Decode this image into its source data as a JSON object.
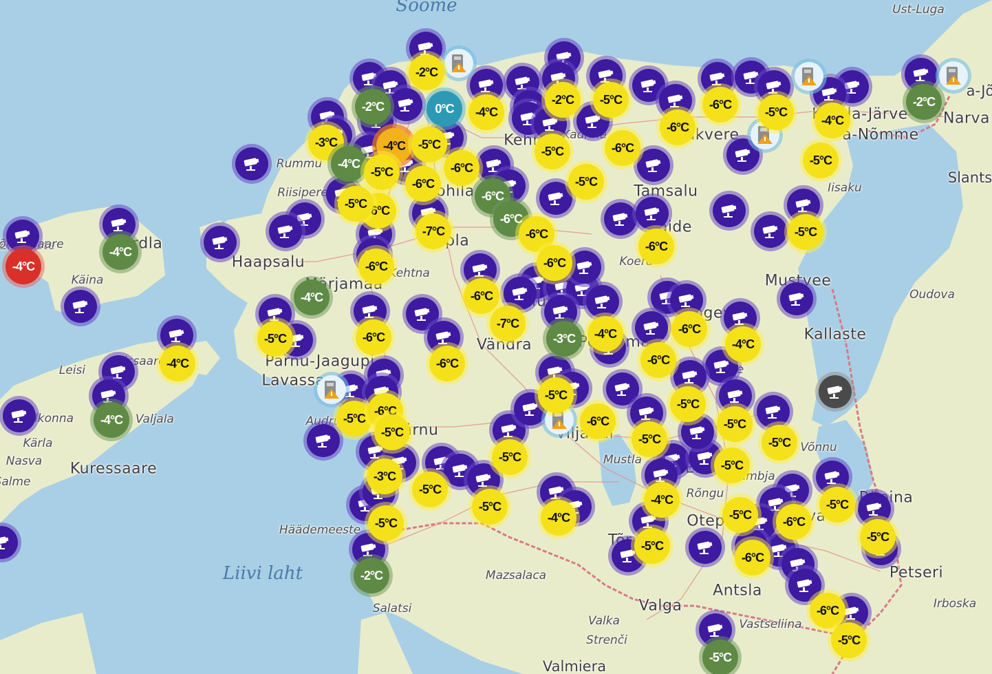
{
  "map": {
    "colors": {
      "sea": "#a9cfe6",
      "land": "#e9eccb",
      "border": "#d57a87",
      "camera": "#3d1aa0",
      "yellow": "#f5e11a",
      "green": "#5e8a45",
      "red": "#d9302a",
      "teal": "#2d9ab5"
    },
    "places": [
      {
        "text": "Soome",
        "size": "sea"
      },
      {
        "text": "Ust-Luga",
        "size": "sm"
      },
      {
        "text": "a-Jõ",
        "size": "md"
      },
      {
        "text": "Narva",
        "size": "lg"
      },
      {
        "text": "Slants",
        "size": "md"
      },
      {
        "text": "Kohtla-Järve",
        "size": "lg"
      },
      {
        "text": "a-Nõmme",
        "size": "lg"
      },
      {
        "text": "Iisaku",
        "size": "sm"
      },
      {
        "text": "Rakvere",
        "size": "lg"
      },
      {
        "text": "Kadrina",
        "size": "sm"
      },
      {
        "text": "Kehra",
        "size": "lg"
      },
      {
        "text": "Tamsalu",
        "size": "lg"
      },
      {
        "text": "Paide",
        "size": "lg"
      },
      {
        "text": "Koeru",
        "size": "sm"
      },
      {
        "text": "Mustvee",
        "size": "lg"
      },
      {
        "text": "Oudova",
        "size": "sm"
      },
      {
        "text": "Kallaste",
        "size": "lg"
      },
      {
        "text": "Jõgeva",
        "size": "lg"
      },
      {
        "text": "Põltsamaa",
        "size": "lg"
      },
      {
        "text": "Palamuse",
        "size": "sm"
      },
      {
        "text": "Rummu",
        "size": "sm"
      },
      {
        "text": "Riisipere",
        "size": "sm"
      },
      {
        "text": "Rapla",
        "size": "lg"
      },
      {
        "text": "Kohila",
        "size": "lg"
      },
      {
        "text": "Kehtna",
        "size": "sm"
      },
      {
        "text": "Haapsalu",
        "size": "lg"
      },
      {
        "text": "Märjamaa",
        "size": "lg"
      },
      {
        "text": "Türi",
        "size": "lg"
      },
      {
        "text": "Vändra",
        "size": "lg"
      },
      {
        "text": "Pärnu-Jaagupi",
        "size": "lg"
      },
      {
        "text": "Lavassaare",
        "size": "lg"
      },
      {
        "text": "Audru",
        "size": "sm"
      },
      {
        "text": "Pärnu",
        "size": "lg"
      },
      {
        "text": "Viljandi",
        "size": "lg"
      },
      {
        "text": "Mustla",
        "size": "sm"
      },
      {
        "text": "Tõrva",
        "size": "lg"
      },
      {
        "text": "Elva",
        "size": "lg"
      },
      {
        "text": "Rõngu",
        "size": "sm"
      },
      {
        "text": "Otepää",
        "size": "lg"
      },
      {
        "text": "Kambja",
        "size": "sm"
      },
      {
        "text": "Võnnu",
        "size": "sm"
      },
      {
        "text": "Räpina",
        "size": "lg"
      },
      {
        "text": "Põlva",
        "size": "lg"
      },
      {
        "text": "Petseri",
        "size": "lg"
      },
      {
        "text": "Irboska",
        "size": "sm"
      },
      {
        "text": "Antsla",
        "size": "lg"
      },
      {
        "text": "Valga",
        "size": "lg"
      },
      {
        "text": "Vastseliina",
        "size": "sm"
      },
      {
        "text": "Valka",
        "size": "sm"
      },
      {
        "text": "Strenči",
        "size": "sm"
      },
      {
        "text": "Valmiera",
        "size": "md"
      },
      {
        "text": "Mazsalaca",
        "size": "sm"
      },
      {
        "text": "Salatsi",
        "size": "sm"
      },
      {
        "text": "Häädemeeste",
        "size": "sm"
      },
      {
        "text": "Liivi laht",
        "size": "sea"
      },
      {
        "text": "Kärdla",
        "size": "lg"
      },
      {
        "text": "Käina",
        "size": "sm"
      },
      {
        "text": "Emmaste",
        "size": "sm"
      },
      {
        "text": "Kõrgessaare",
        "size": "sm"
      },
      {
        "text": "Leisi",
        "size": "sm"
      },
      {
        "text": "Orissaare",
        "size": "sm"
      },
      {
        "text": "Valjala",
        "size": "sm"
      },
      {
        "text": "Kihelkonna",
        "size": "sm"
      },
      {
        "text": "Kärla",
        "size": "sm"
      },
      {
        "text": "Kuressaare",
        "size": "lg"
      },
      {
        "text": "Nasva",
        "size": "sm"
      },
      {
        "text": "Salme",
        "size": "sm"
      }
    ],
    "temperatures": [
      {
        "value": "-2°C",
        "color": "yellow"
      },
      {
        "value": "-2°C",
        "color": "green"
      },
      {
        "value": "0°C",
        "color": "teal"
      },
      {
        "value": "-4°C",
        "color": "yellow"
      },
      {
        "value": "-2°C",
        "color": "yellow"
      },
      {
        "value": "-5°C",
        "color": "yellow"
      },
      {
        "value": "-6°C",
        "color": "yellow"
      },
      {
        "value": "-5°C",
        "color": "yellow"
      },
      {
        "value": "-4°C",
        "color": "yellow"
      },
      {
        "value": "-2°C",
        "color": "green"
      },
      {
        "value": "-3°C",
        "color": "yellow"
      },
      {
        "value": "-4°C",
        "color": "green"
      },
      {
        "value": "-4°C",
        "color": "orange"
      },
      {
        "value": "-5°C",
        "color": "yellow"
      },
      {
        "value": "-5°C",
        "color": "yellow"
      },
      {
        "value": "-6°C",
        "color": "yellow"
      },
      {
        "value": "-6°C",
        "color": "yellow"
      },
      {
        "value": "-5°C",
        "color": "yellow"
      },
      {
        "value": "-6°C",
        "color": "yellow"
      },
      {
        "value": "-6°C",
        "color": "yellow"
      },
      {
        "value": "-5°C",
        "color": "yellow"
      },
      {
        "value": "-6°C",
        "color": "green"
      },
      {
        "value": "-6°C",
        "color": "green"
      },
      {
        "value": "-5°C",
        "color": "yellow"
      },
      {
        "value": "-6°C",
        "color": "yellow"
      },
      {
        "value": "-7°C",
        "color": "yellow"
      },
      {
        "value": "-5°C",
        "color": "yellow"
      },
      {
        "value": "-6°C",
        "color": "yellow"
      },
      {
        "value": "-6°C",
        "color": "yellow"
      },
      {
        "value": "-5°C",
        "color": "yellow"
      },
      {
        "value": "-6°C",
        "color": "yellow"
      },
      {
        "value": "-6°C",
        "color": "yellow"
      },
      {
        "value": "-4°C",
        "color": "green"
      },
      {
        "value": "-6°C",
        "color": "yellow"
      },
      {
        "value": "-7°C",
        "color": "yellow"
      },
      {
        "value": "-3°C",
        "color": "green"
      },
      {
        "value": "-4°C",
        "color": "yellow"
      },
      {
        "value": "-6°C",
        "color": "yellow"
      },
      {
        "value": "-6°C",
        "color": "yellow"
      },
      {
        "value": "-4°C",
        "color": "yellow"
      },
      {
        "value": "-5°C",
        "color": "yellow"
      },
      {
        "value": "-6°C",
        "color": "yellow"
      },
      {
        "value": "-6°C",
        "color": "yellow"
      },
      {
        "value": "-4°C",
        "color": "yellow"
      },
      {
        "value": "-4°C",
        "color": "green"
      },
      {
        "value": "-4°C",
        "color": "red"
      },
      {
        "value": "-4°C",
        "color": "green"
      },
      {
        "value": "-5°C",
        "color": "yellow"
      },
      {
        "value": "-6°C",
        "color": "yellow"
      },
      {
        "value": "-5°C",
        "color": "yellow"
      },
      {
        "value": "-5°C",
        "color": "yellow"
      },
      {
        "value": "-6°C",
        "color": "yellow"
      },
      {
        "value": "-5°C",
        "color": "yellow"
      },
      {
        "value": "-5°C",
        "color": "yellow"
      },
      {
        "value": "-5°C",
        "color": "yellow"
      },
      {
        "value": "-3°C",
        "color": "yellow"
      },
      {
        "value": "-5°C",
        "color": "yellow"
      },
      {
        "value": "-5°C",
        "color": "yellow"
      },
      {
        "value": "-5°C",
        "color": "yellow"
      },
      {
        "value": "-5°C",
        "color": "yellow"
      },
      {
        "value": "-5°C",
        "color": "yellow"
      },
      {
        "value": "-5°C",
        "color": "yellow"
      },
      {
        "value": "-4°C",
        "color": "yellow"
      },
      {
        "value": "-4°C",
        "color": "yellow"
      },
      {
        "value": "-5°C",
        "color": "yellow"
      },
      {
        "value": "-5°C",
        "color": "yellow"
      },
      {
        "value": "-6°C",
        "color": "yellow"
      },
      {
        "value": "-5°C",
        "color": "yellow"
      },
      {
        "value": "-5°C",
        "color": "yellow"
      },
      {
        "value": "-6°C",
        "color": "yellow"
      },
      {
        "value": "-2°C",
        "color": "green"
      },
      {
        "value": "-6°C",
        "color": "yellow"
      },
      {
        "value": "-5°C",
        "color": "yellow"
      },
      {
        "value": "-5°C",
        "color": "green"
      }
    ],
    "camera_count": 92,
    "grey_camera_count": 1,
    "warning_count": 6
  }
}
